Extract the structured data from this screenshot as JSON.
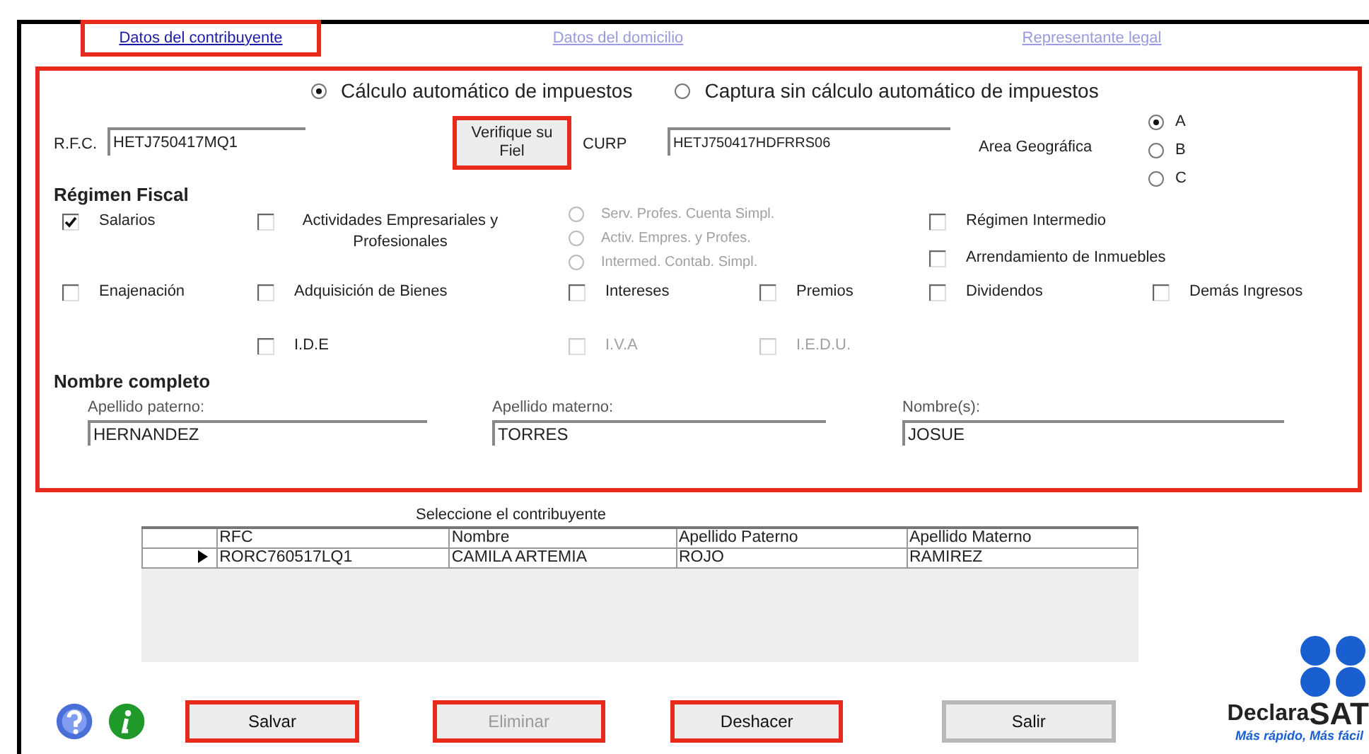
{
  "tabs": [
    {
      "label": "Datos del contribuyente",
      "selected": true,
      "highlighted": true
    },
    {
      "label": "Datos del domicilio",
      "selected": false,
      "highlighted": false
    },
    {
      "label": "Representante legal",
      "selected": false,
      "highlighted": false
    }
  ],
  "section_highlighted": true,
  "calc_mode": [
    {
      "label": "Cálculo automático de impuestos",
      "selected": true
    },
    {
      "label": "Captura sin cálculo automático de impuestos",
      "selected": false
    }
  ],
  "rfc": {
    "label": "R.F.C.",
    "value": "HETJ750417MQ1"
  },
  "verify_button": {
    "label": "Verifique su Fiel",
    "highlighted": true
  },
  "curp": {
    "label": "CURP",
    "value": "HETJ750417HDFRRS06"
  },
  "area": {
    "label": "Area Geográfica",
    "options": [
      {
        "label": "A",
        "selected": true
      },
      {
        "label": "B",
        "selected": false
      },
      {
        "label": "C",
        "selected": false
      }
    ]
  },
  "regimen": {
    "title": "Régimen Fiscal",
    "items": [
      {
        "kind": "checkbox",
        "label": "Salarios",
        "checked": true,
        "disabled": false
      },
      {
        "kind": "checkbox",
        "label": "Actividades Empresariales y Profesionales",
        "checked": false,
        "disabled": false
      },
      {
        "kind": "radio_group",
        "options": [
          {
            "label": "Serv. Profes. Cuenta Simpl.",
            "selected": false
          },
          {
            "label": "Activ. Empres. y Profes.",
            "selected": false
          },
          {
            "label": "Intermed. Contab. Simpl.",
            "selected": false
          }
        ],
        "disabled": true
      },
      {
        "kind": "checkbox",
        "label": "Régimen Intermedio",
        "checked": false,
        "disabled": false
      },
      {
        "kind": "checkbox",
        "label": "Arrendamiento de Inmuebles",
        "checked": false,
        "disabled": false
      },
      {
        "kind": "checkbox",
        "label": "Enajenación",
        "checked": false,
        "disabled": false
      },
      {
        "kind": "checkbox",
        "label": "Adquisición de Bienes",
        "checked": false,
        "disabled": false
      },
      {
        "kind": "checkbox",
        "label": "Intereses",
        "checked": false,
        "disabled": false
      },
      {
        "kind": "checkbox",
        "label": "Premios",
        "checked": false,
        "disabled": false
      },
      {
        "kind": "checkbox",
        "label": "Dividendos",
        "checked": false,
        "disabled": false
      },
      {
        "kind": "checkbox",
        "label": "Demás Ingresos",
        "checked": false,
        "disabled": false
      },
      {
        "kind": "checkbox",
        "label": "I.D.E",
        "checked": false,
        "disabled": false
      },
      {
        "kind": "checkbox",
        "label": "I.V.A",
        "checked": false,
        "disabled": true
      },
      {
        "kind": "checkbox",
        "label": "I.E.D.U.",
        "checked": false,
        "disabled": true
      }
    ]
  },
  "nombre": {
    "title": "Nombre completo",
    "fields": [
      {
        "label": "Apellido paterno:",
        "value": "HERNANDEZ"
      },
      {
        "label": "Apellido materno:",
        "value": "TORRES"
      },
      {
        "label": "Nombre(s):",
        "value": "JOSUE"
      }
    ]
  },
  "table": {
    "title": "Seleccione el contribuyente",
    "columns": [
      "RFC",
      "Nombre",
      "Apellido Paterno",
      "Apellido Materno"
    ],
    "rows": [
      {
        "selected": true,
        "cells": [
          "RORC760517LQ1",
          "CAMILA ARTEMIA",
          "ROJO",
          "RAMIREZ"
        ]
      }
    ]
  },
  "buttons": [
    {
      "label": "Salvar",
      "disabled": false,
      "highlighted": true
    },
    {
      "label": "Eliminar",
      "disabled": true,
      "highlighted": true
    },
    {
      "label": "Deshacer",
      "disabled": false,
      "highlighted": true
    },
    {
      "label": "Salir",
      "disabled": false,
      "highlighted": false
    }
  ],
  "logo": {
    "word": "Declara",
    "brand": "SAT",
    "tagline": "Más rápido, Más fácil"
  }
}
